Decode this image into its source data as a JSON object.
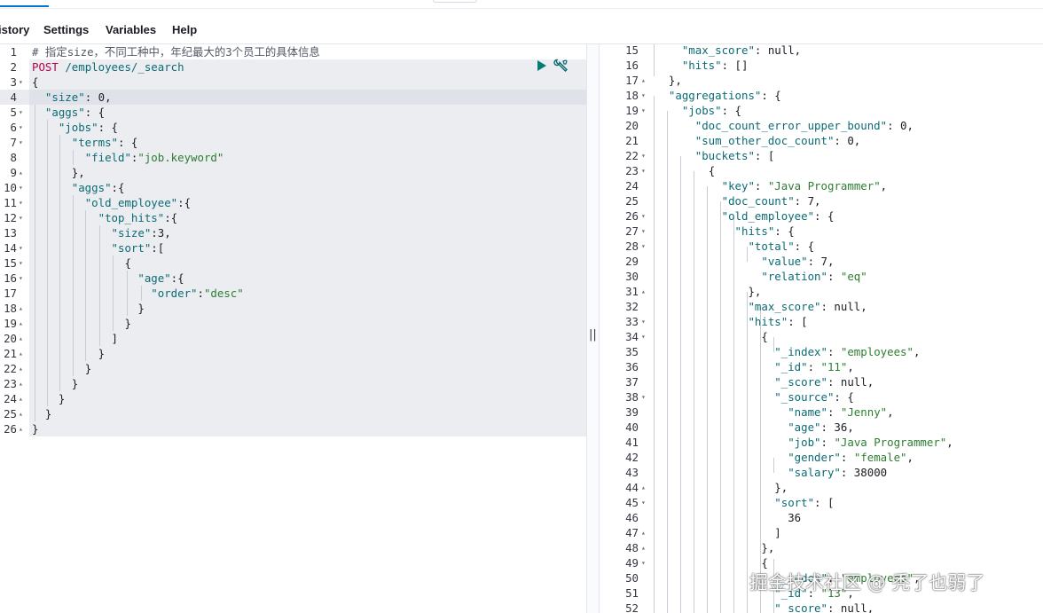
{
  "menu": {
    "history": "istory",
    "settings": "Settings",
    "variables": "Variables",
    "help": "Help"
  },
  "request_lines": [
    {
      "n": "1",
      "fold": "",
      "html": "<span class='cm'># 指定size，不同工种中，年纪最大的3个员工的具体信息</span>"
    },
    {
      "n": "2",
      "fold": "",
      "html": "<span class='kw'>POST</span> <span class='u'>/employees/_search</span>"
    },
    {
      "n": "3",
      "fold": "▾",
      "html": "<span class='n'>{</span>"
    },
    {
      "n": "4",
      "fold": "",
      "html": "  <span class='k'>\"size\"</span><span class='n'>: 0,</span>"
    },
    {
      "n": "5",
      "fold": "▾",
      "html": "  <span class='k'>\"aggs\"</span><span class='n'>: {</span>"
    },
    {
      "n": "6",
      "fold": "▾",
      "html": "    <span class='k'>\"jobs\"</span><span class='n'>: {</span>"
    },
    {
      "n": "7",
      "fold": "▾",
      "html": "      <span class='k'>\"terms\"</span><span class='n'>: {</span>"
    },
    {
      "n": "8",
      "fold": "",
      "html": "        <span class='k'>\"field\"</span><span class='n'>:</span><span class='s'>\"job.keyword\"</span>"
    },
    {
      "n": "9",
      "fold": "▴",
      "html": "      <span class='n'>},</span>"
    },
    {
      "n": "10",
      "fold": "▾",
      "html": "      <span class='k'>\"aggs\"</span><span class='n'>:{</span>"
    },
    {
      "n": "11",
      "fold": "▾",
      "html": "        <span class='k'>\"old_employee\"</span><span class='n'>:{</span>"
    },
    {
      "n": "12",
      "fold": "▾",
      "html": "          <span class='k'>\"top_hits\"</span><span class='n'>:{</span>"
    },
    {
      "n": "13",
      "fold": "",
      "html": "            <span class='k'>\"size\"</span><span class='n'>:3,</span>"
    },
    {
      "n": "14",
      "fold": "▾",
      "html": "            <span class='k'>\"sort\"</span><span class='n'>:[</span>"
    },
    {
      "n": "15",
      "fold": "▾",
      "html": "              <span class='n'>{</span>"
    },
    {
      "n": "16",
      "fold": "▾",
      "html": "                <span class='k'>\"age\"</span><span class='n'>:{</span>"
    },
    {
      "n": "17",
      "fold": "",
      "html": "                  <span class='k'>\"order\"</span><span class='n'>:</span><span class='s'>\"desc\"</span>"
    },
    {
      "n": "18",
      "fold": "▴",
      "html": "                <span class='n'>}</span>"
    },
    {
      "n": "19",
      "fold": "▴",
      "html": "              <span class='n'>}</span>"
    },
    {
      "n": "20",
      "fold": "▴",
      "html": "            <span class='n'>]</span>"
    },
    {
      "n": "21",
      "fold": "▴",
      "html": "          <span class='n'>}</span>"
    },
    {
      "n": "22",
      "fold": "▴",
      "html": "        <span class='n'>}</span>"
    },
    {
      "n": "23",
      "fold": "▴",
      "html": "      <span class='n'>}</span>"
    },
    {
      "n": "24",
      "fold": "▴",
      "html": "    <span class='n'>}</span>"
    },
    {
      "n": "25",
      "fold": "▴",
      "html": "  <span class='n'>}</span>"
    },
    {
      "n": "26",
      "fold": "▴",
      "html": "<span class='n'>}</span>"
    }
  ],
  "response_lines": [
    {
      "n": "15",
      "fold": "",
      "html": "    <span class='k'>\"max_score\"</span><span class='n'>: null,</span>"
    },
    {
      "n": "16",
      "fold": "",
      "html": "    <span class='k'>\"hits\"</span><span class='n'>: []</span>"
    },
    {
      "n": "17",
      "fold": "▴",
      "html": "  <span class='n'>},</span>"
    },
    {
      "n": "18",
      "fold": "▾",
      "html": "  <span class='k'>\"aggregations\"</span><span class='n'>: {</span>"
    },
    {
      "n": "19",
      "fold": "▾",
      "html": "    <span class='k'>\"jobs\"</span><span class='n'>: {</span>"
    },
    {
      "n": "20",
      "fold": "",
      "html": "      <span class='k'>\"doc_count_error_upper_bound\"</span><span class='n'>: 0,</span>"
    },
    {
      "n": "21",
      "fold": "",
      "html": "      <span class='k'>\"sum_other_doc_count\"</span><span class='n'>: 0,</span>"
    },
    {
      "n": "22",
      "fold": "▾",
      "html": "      <span class='k'>\"buckets\"</span><span class='n'>: [</span>"
    },
    {
      "n": "23",
      "fold": "▾",
      "html": "        <span class='n'>{</span>"
    },
    {
      "n": "24",
      "fold": "",
      "html": "          <span class='k'>\"key\"</span><span class='n'>: </span><span class='s'>\"Java Programmer\"</span><span class='n'>,</span>"
    },
    {
      "n": "25",
      "fold": "",
      "html": "          <span class='k'>\"doc_count\"</span><span class='n'>: 7,</span>"
    },
    {
      "n": "26",
      "fold": "▾",
      "html": "          <span class='k'>\"old_employee\"</span><span class='n'>: {</span>"
    },
    {
      "n": "27",
      "fold": "▾",
      "html": "            <span class='k'>\"hits\"</span><span class='n'>: {</span>"
    },
    {
      "n": "28",
      "fold": "▾",
      "html": "              <span class='k'>\"total\"</span><span class='n'>: {</span>"
    },
    {
      "n": "29",
      "fold": "",
      "html": "                <span class='k'>\"value\"</span><span class='n'>: 7,</span>"
    },
    {
      "n": "30",
      "fold": "",
      "html": "                <span class='k'>\"relation\"</span><span class='n'>: </span><span class='s'>\"eq\"</span>"
    },
    {
      "n": "31",
      "fold": "▴",
      "html": "              <span class='n'>},</span>"
    },
    {
      "n": "32",
      "fold": "",
      "html": "              <span class='k'>\"max_score\"</span><span class='n'>: null,</span>"
    },
    {
      "n": "33",
      "fold": "▾",
      "html": "              <span class='k'>\"hits\"</span><span class='n'>: [</span>"
    },
    {
      "n": "34",
      "fold": "▾",
      "html": "                <span class='n'>{</span>"
    },
    {
      "n": "35",
      "fold": "",
      "html": "                  <span class='k'>\"_index\"</span><span class='n'>: </span><span class='s'>\"employees\"</span><span class='n'>,</span>"
    },
    {
      "n": "36",
      "fold": "",
      "html": "                  <span class='k'>\"_id\"</span><span class='n'>: </span><span class='s'>\"11\"</span><span class='n'>,</span>"
    },
    {
      "n": "37",
      "fold": "",
      "html": "                  <span class='k'>\"_score\"</span><span class='n'>: null,</span>"
    },
    {
      "n": "38",
      "fold": "▾",
      "html": "                  <span class='k'>\"_source\"</span><span class='n'>: {</span>"
    },
    {
      "n": "39",
      "fold": "",
      "html": "                    <span class='k'>\"name\"</span><span class='n'>: </span><span class='s'>\"Jenny\"</span><span class='n'>,</span>"
    },
    {
      "n": "40",
      "fold": "",
      "html": "                    <span class='k'>\"age\"</span><span class='n'>: 36,</span>"
    },
    {
      "n": "41",
      "fold": "",
      "html": "                    <span class='k'>\"job\"</span><span class='n'>: </span><span class='s'>\"Java Programmer\"</span><span class='n'>,</span>"
    },
    {
      "n": "42",
      "fold": "",
      "html": "                    <span class='k'>\"gender\"</span><span class='n'>: </span><span class='s'>\"female\"</span><span class='n'>,</span>"
    },
    {
      "n": "43",
      "fold": "",
      "html": "                    <span class='k'>\"salary\"</span><span class='n'>: 38000</span>"
    },
    {
      "n": "44",
      "fold": "▴",
      "html": "                  <span class='n'>},</span>"
    },
    {
      "n": "45",
      "fold": "▾",
      "html": "                  <span class='k'>\"sort\"</span><span class='n'>: [</span>"
    },
    {
      "n": "46",
      "fold": "",
      "html": "                    <span class='n'>36</span>"
    },
    {
      "n": "47",
      "fold": "▴",
      "html": "                  <span class='n'>]</span>"
    },
    {
      "n": "48",
      "fold": "▴",
      "html": "                <span class='n'>},</span>"
    },
    {
      "n": "49",
      "fold": "▾",
      "html": "                <span class='n'>{</span>"
    },
    {
      "n": "50",
      "fold": "",
      "html": "                  <span class='k'>\"_index\"</span><span class='n'>: </span><span class='s'>\"employees\"</span><span class='n'>,</span>"
    },
    {
      "n": "51",
      "fold": "",
      "html": "                  <span class='k'>\"_id\"</span><span class='n'>: </span><span class='s'>\"13\"</span><span class='n'>,</span>"
    },
    {
      "n": "52",
      "fold": "",
      "html": "                  <span class='k'>\"_score\"</span><span class='n'>: null,</span>"
    }
  ],
  "divider_handle": "||",
  "watermark": "掘金技术社区 @ 秃了也弱了"
}
